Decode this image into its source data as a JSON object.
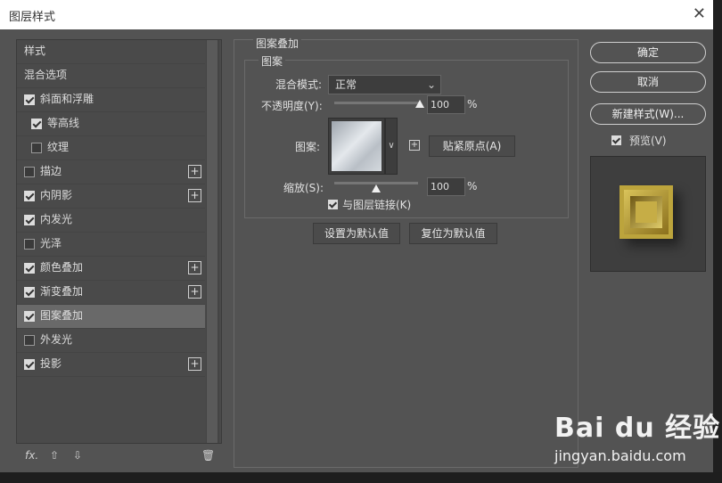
{
  "window": {
    "title": "图层样式"
  },
  "left_panel": {
    "items": [
      {
        "label": "样式",
        "kind": "header"
      },
      {
        "label": "混合选项",
        "kind": "header"
      },
      {
        "label": "斜面和浮雕",
        "checked": true
      },
      {
        "label": "等高线",
        "checked": true,
        "sub": true
      },
      {
        "label": "纹理",
        "checked": false,
        "sub": true
      },
      {
        "label": "描边",
        "checked": false,
        "plus": true
      },
      {
        "label": "内阴影",
        "checked": true,
        "plus": true
      },
      {
        "label": "内发光",
        "checked": true
      },
      {
        "label": "光泽",
        "checked": false
      },
      {
        "label": "颜色叠加",
        "checked": true,
        "plus": true
      },
      {
        "label": "渐变叠加",
        "checked": true,
        "plus": true
      },
      {
        "label": "图案叠加",
        "checked": true,
        "selected": true
      },
      {
        "label": "外发光",
        "checked": false
      },
      {
        "label": "投影",
        "checked": true,
        "plus": true
      }
    ],
    "footer": {
      "fx": "fx.",
      "up": "⇧",
      "down": "⇩",
      "trash": "🗑"
    }
  },
  "pattern_overlay": {
    "title": "图案叠加",
    "group": "图案",
    "blend_mode_label": "混合模式:",
    "blend_mode_value": "正常",
    "opacity_label": "不透明度(Y):",
    "opacity_value": "100",
    "opacity_fraction": 1.0,
    "percent": "%",
    "pattern_label": "图案:",
    "snap_button": "贴紧原点(A)",
    "scale_label": "缩放(S):",
    "scale_value": "100",
    "scale_fraction": 0.5,
    "link_label": "与图层链接(K)",
    "link_checked": true,
    "set_default": "设置为默认值",
    "reset_default": "复位为默认值"
  },
  "right": {
    "ok": "确定",
    "cancel": "取消",
    "new_style": "新建样式(W)...",
    "preview_label": "预览(V)",
    "preview_checked": true
  },
  "watermark": {
    "logo": "Bai du 经验",
    "url": "jingyan.baidu.com"
  },
  "colors": {
    "dialog_bg": "#535353",
    "panel_bg": "#4a4a4a",
    "selected_row": "#696969",
    "gold": "#c6ad46"
  }
}
